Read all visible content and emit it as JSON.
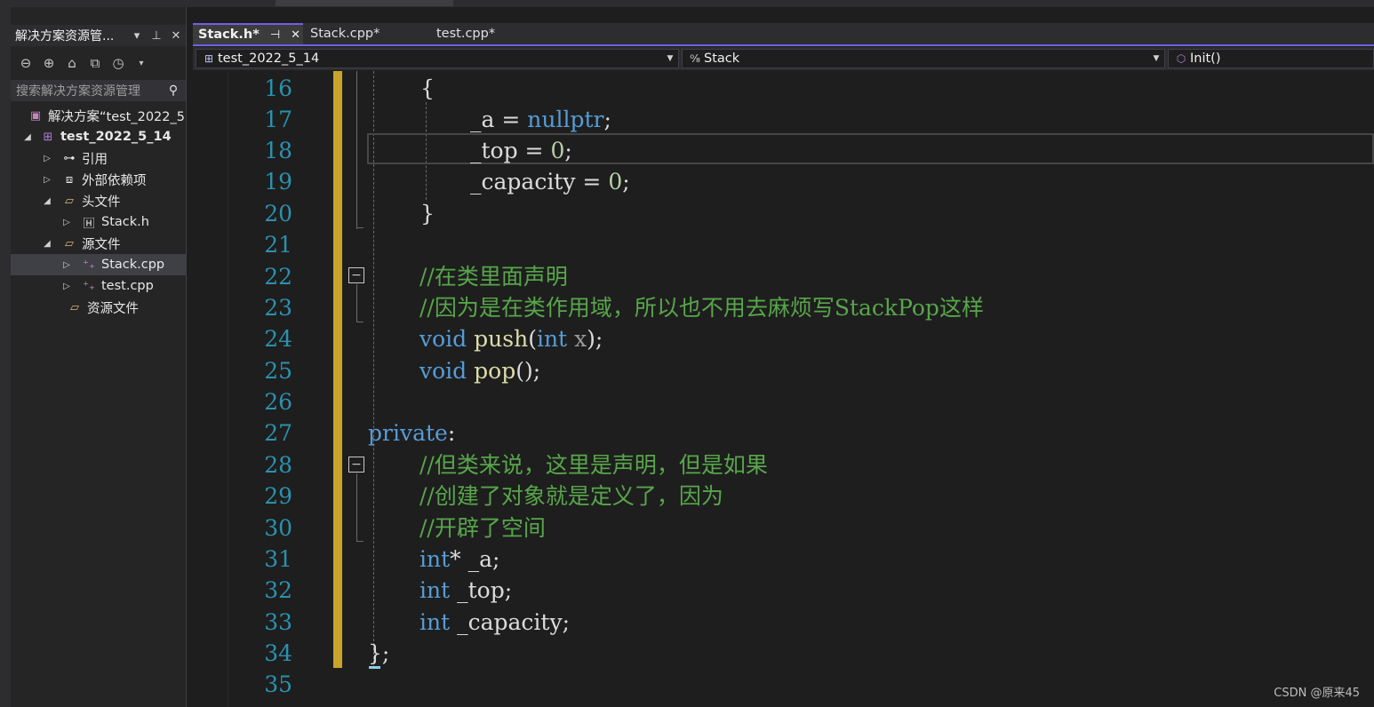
{
  "solution_explorer": {
    "title": "解决方案资源管...",
    "search_placeholder": "搜索解决方案资源管理",
    "items": [
      {
        "label": "解决方案“test_2022_5",
        "arrow": "",
        "icon": "solution-icon"
      },
      {
        "label": "test_2022_5_14",
        "arrow": "◢",
        "icon": "project-icon"
      },
      {
        "label": "引用",
        "arrow": "▷",
        "icon": "references-icon"
      },
      {
        "label": "外部依赖项",
        "arrow": "▷",
        "icon": "external-deps-icon"
      },
      {
        "label": "头文件",
        "arrow": "◢",
        "icon": "folder-filter-icon"
      },
      {
        "label": "Stack.h",
        "arrow": "▷",
        "icon": "header-file-icon"
      },
      {
        "label": "源文件",
        "arrow": "◢",
        "icon": "folder-filter-icon"
      },
      {
        "label": "Stack.cpp",
        "arrow": "▷",
        "icon": "cpp-file-icon"
      },
      {
        "label": "test.cpp",
        "arrow": "▷",
        "icon": "cpp-file-icon"
      },
      {
        "label": "资源文件",
        "arrow": "",
        "icon": "folder-filter-icon"
      }
    ]
  },
  "tabs": [
    {
      "label": "Stack.h*",
      "active": true
    },
    {
      "label": "Stack.cpp*",
      "active": false
    },
    {
      "label": "test.cpp*",
      "active": false
    }
  ],
  "navbar": {
    "project": "test_2022_5_14",
    "scope": "Stack",
    "member": "Init()"
  },
  "editor": {
    "line_numbers": [
      "16",
      "17",
      "18",
      "19",
      "20",
      "21",
      "22",
      "23",
      "24",
      "25",
      "26",
      "27",
      "28",
      "29",
      "30",
      "31",
      "32",
      "33",
      "34",
      "35"
    ],
    "comments": {
      "c22": "//在类里面声明",
      "c23": "//因为是在类作用域，所以也不用去麻烦写StackPop这样",
      "c28": "//但类来说，这里是声明，但是如果",
      "c29": "//创建了对象就是定义了，因为",
      "c30": "//开辟了空间"
    }
  },
  "watermark": "CSDN @原来45",
  "colors": {
    "accent": "#7160e8",
    "change_bar": "#c8a52a",
    "keyword": "#569cd6",
    "comment": "#57a64a",
    "number": "#b5cea8",
    "line_number": "#2b91af"
  }
}
